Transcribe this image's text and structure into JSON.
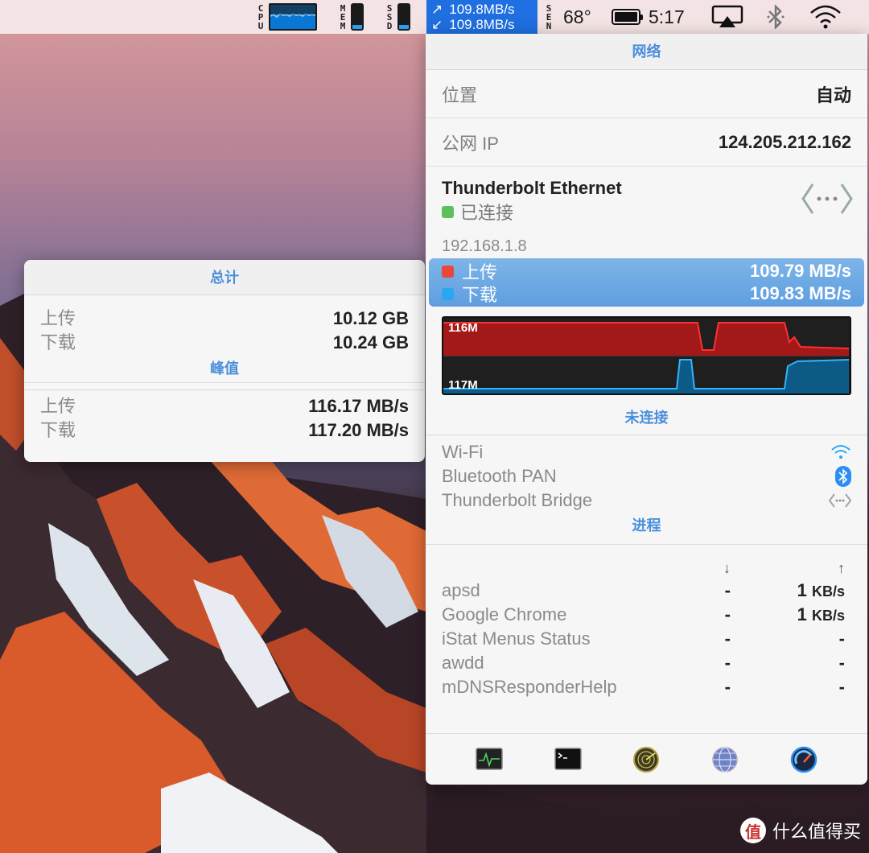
{
  "menubar": {
    "cpu_label": [
      "C",
      "P",
      "U"
    ],
    "mem_label": [
      "M",
      "E",
      "M"
    ],
    "ssd_label": [
      "S",
      "S",
      "D"
    ],
    "sen_label": [
      "S",
      "E",
      "N"
    ],
    "mem_fill_fraction": 0.16,
    "ssd_fill_fraction": 0.16,
    "net_up": "109.8MB/s",
    "net_down": "109.8MB/s",
    "up_arrow": "↗",
    "down_arrow": "↙",
    "temperature": "68°",
    "clock": "5:17",
    "colors": {
      "net_meter_bg": "#1f6fe0",
      "cpu_graph": "#0a77d5"
    }
  },
  "total_panel": {
    "title": "总计",
    "upload_label": "上传",
    "upload_value": "10.12 GB",
    "download_label": "下载",
    "download_value": "10.24 GB",
    "peak_title": "峰值",
    "peak_upload_label": "上传",
    "peak_upload_value": "116.17 MB/s",
    "peak_download_label": "下载",
    "peak_download_value": "117.20 MB/s"
  },
  "network_panel": {
    "title": "网络",
    "location_label": "位置",
    "location_value": "自动",
    "public_ip_label": "公网 IP",
    "public_ip_value": "124.205.212.162",
    "interface_name": "Thunderbolt Ethernet",
    "interface_status": "已连接",
    "interface_ip": "192.168.1.8",
    "upload_label": "上传",
    "upload_rate": "109.79 MB/s",
    "download_label": "下载",
    "download_rate": "109.83 MB/s",
    "graph_upload_label": "116M",
    "graph_download_label": "117M",
    "colors": {
      "upload": "#e8473c",
      "download": "#2aa7f0",
      "connected": "#5cc05c"
    },
    "disconnected_title": "未连接",
    "disconnected": [
      "Wi-Fi",
      "Bluetooth PAN",
      "Thunderbolt Bridge"
    ],
    "process_title": "进程",
    "process_down_icon": "↓",
    "process_up_icon": "↑",
    "processes": [
      {
        "name": "apsd",
        "down": "-",
        "up_num": "1",
        "up_unit": "KB/s"
      },
      {
        "name": "Google Chrome",
        "down": "-",
        "up_num": "1",
        "up_unit": "KB/s"
      },
      {
        "name": "iStat Menus Status",
        "down": "-",
        "up_num": "-",
        "up_unit": ""
      },
      {
        "name": "awdd",
        "down": "-",
        "up_num": "-",
        "up_unit": ""
      },
      {
        "name": "mDNSResponderHelp",
        "down": "-",
        "up_num": "-",
        "up_unit": ""
      }
    ],
    "footer_icons": [
      "activity-monitor-icon",
      "terminal-icon",
      "network-radar-icon",
      "network-utility-icon",
      "speedtest-icon"
    ]
  },
  "watermark": {
    "text": "什么值得买",
    "logo_char": "值"
  }
}
